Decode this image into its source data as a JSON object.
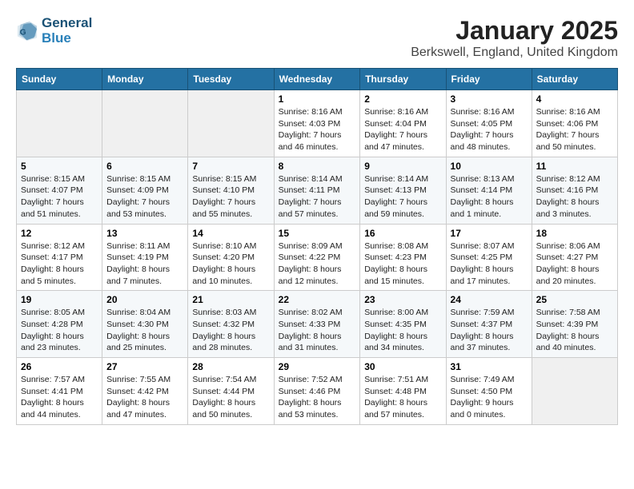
{
  "header": {
    "logo_line1": "General",
    "logo_line2": "Blue",
    "title": "January 2025",
    "subtitle": "Berkswell, England, United Kingdom"
  },
  "weekdays": [
    "Sunday",
    "Monday",
    "Tuesday",
    "Wednesday",
    "Thursday",
    "Friday",
    "Saturday"
  ],
  "weeks": [
    [
      {
        "day": "",
        "detail": ""
      },
      {
        "day": "",
        "detail": ""
      },
      {
        "day": "",
        "detail": ""
      },
      {
        "day": "1",
        "detail": "Sunrise: 8:16 AM\nSunset: 4:03 PM\nDaylight: 7 hours and 46 minutes."
      },
      {
        "day": "2",
        "detail": "Sunrise: 8:16 AM\nSunset: 4:04 PM\nDaylight: 7 hours and 47 minutes."
      },
      {
        "day": "3",
        "detail": "Sunrise: 8:16 AM\nSunset: 4:05 PM\nDaylight: 7 hours and 48 minutes."
      },
      {
        "day": "4",
        "detail": "Sunrise: 8:16 AM\nSunset: 4:06 PM\nDaylight: 7 hours and 50 minutes."
      }
    ],
    [
      {
        "day": "5",
        "detail": "Sunrise: 8:15 AM\nSunset: 4:07 PM\nDaylight: 7 hours and 51 minutes."
      },
      {
        "day": "6",
        "detail": "Sunrise: 8:15 AM\nSunset: 4:09 PM\nDaylight: 7 hours and 53 minutes."
      },
      {
        "day": "7",
        "detail": "Sunrise: 8:15 AM\nSunset: 4:10 PM\nDaylight: 7 hours and 55 minutes."
      },
      {
        "day": "8",
        "detail": "Sunrise: 8:14 AM\nSunset: 4:11 PM\nDaylight: 7 hours and 57 minutes."
      },
      {
        "day": "9",
        "detail": "Sunrise: 8:14 AM\nSunset: 4:13 PM\nDaylight: 7 hours and 59 minutes."
      },
      {
        "day": "10",
        "detail": "Sunrise: 8:13 AM\nSunset: 4:14 PM\nDaylight: 8 hours and 1 minute."
      },
      {
        "day": "11",
        "detail": "Sunrise: 8:12 AM\nSunset: 4:16 PM\nDaylight: 8 hours and 3 minutes."
      }
    ],
    [
      {
        "day": "12",
        "detail": "Sunrise: 8:12 AM\nSunset: 4:17 PM\nDaylight: 8 hours and 5 minutes."
      },
      {
        "day": "13",
        "detail": "Sunrise: 8:11 AM\nSunset: 4:19 PM\nDaylight: 8 hours and 7 minutes."
      },
      {
        "day": "14",
        "detail": "Sunrise: 8:10 AM\nSunset: 4:20 PM\nDaylight: 8 hours and 10 minutes."
      },
      {
        "day": "15",
        "detail": "Sunrise: 8:09 AM\nSunset: 4:22 PM\nDaylight: 8 hours and 12 minutes."
      },
      {
        "day": "16",
        "detail": "Sunrise: 8:08 AM\nSunset: 4:23 PM\nDaylight: 8 hours and 15 minutes."
      },
      {
        "day": "17",
        "detail": "Sunrise: 8:07 AM\nSunset: 4:25 PM\nDaylight: 8 hours and 17 minutes."
      },
      {
        "day": "18",
        "detail": "Sunrise: 8:06 AM\nSunset: 4:27 PM\nDaylight: 8 hours and 20 minutes."
      }
    ],
    [
      {
        "day": "19",
        "detail": "Sunrise: 8:05 AM\nSunset: 4:28 PM\nDaylight: 8 hours and 23 minutes."
      },
      {
        "day": "20",
        "detail": "Sunrise: 8:04 AM\nSunset: 4:30 PM\nDaylight: 8 hours and 25 minutes."
      },
      {
        "day": "21",
        "detail": "Sunrise: 8:03 AM\nSunset: 4:32 PM\nDaylight: 8 hours and 28 minutes."
      },
      {
        "day": "22",
        "detail": "Sunrise: 8:02 AM\nSunset: 4:33 PM\nDaylight: 8 hours and 31 minutes."
      },
      {
        "day": "23",
        "detail": "Sunrise: 8:00 AM\nSunset: 4:35 PM\nDaylight: 8 hours and 34 minutes."
      },
      {
        "day": "24",
        "detail": "Sunrise: 7:59 AM\nSunset: 4:37 PM\nDaylight: 8 hours and 37 minutes."
      },
      {
        "day": "25",
        "detail": "Sunrise: 7:58 AM\nSunset: 4:39 PM\nDaylight: 8 hours and 40 minutes."
      }
    ],
    [
      {
        "day": "26",
        "detail": "Sunrise: 7:57 AM\nSunset: 4:41 PM\nDaylight: 8 hours and 44 minutes."
      },
      {
        "day": "27",
        "detail": "Sunrise: 7:55 AM\nSunset: 4:42 PM\nDaylight: 8 hours and 47 minutes."
      },
      {
        "day": "28",
        "detail": "Sunrise: 7:54 AM\nSunset: 4:44 PM\nDaylight: 8 hours and 50 minutes."
      },
      {
        "day": "29",
        "detail": "Sunrise: 7:52 AM\nSunset: 4:46 PM\nDaylight: 8 hours and 53 minutes."
      },
      {
        "day": "30",
        "detail": "Sunrise: 7:51 AM\nSunset: 4:48 PM\nDaylight: 8 hours and 57 minutes."
      },
      {
        "day": "31",
        "detail": "Sunrise: 7:49 AM\nSunset: 4:50 PM\nDaylight: 9 hours and 0 minutes."
      },
      {
        "day": "",
        "detail": ""
      }
    ]
  ]
}
